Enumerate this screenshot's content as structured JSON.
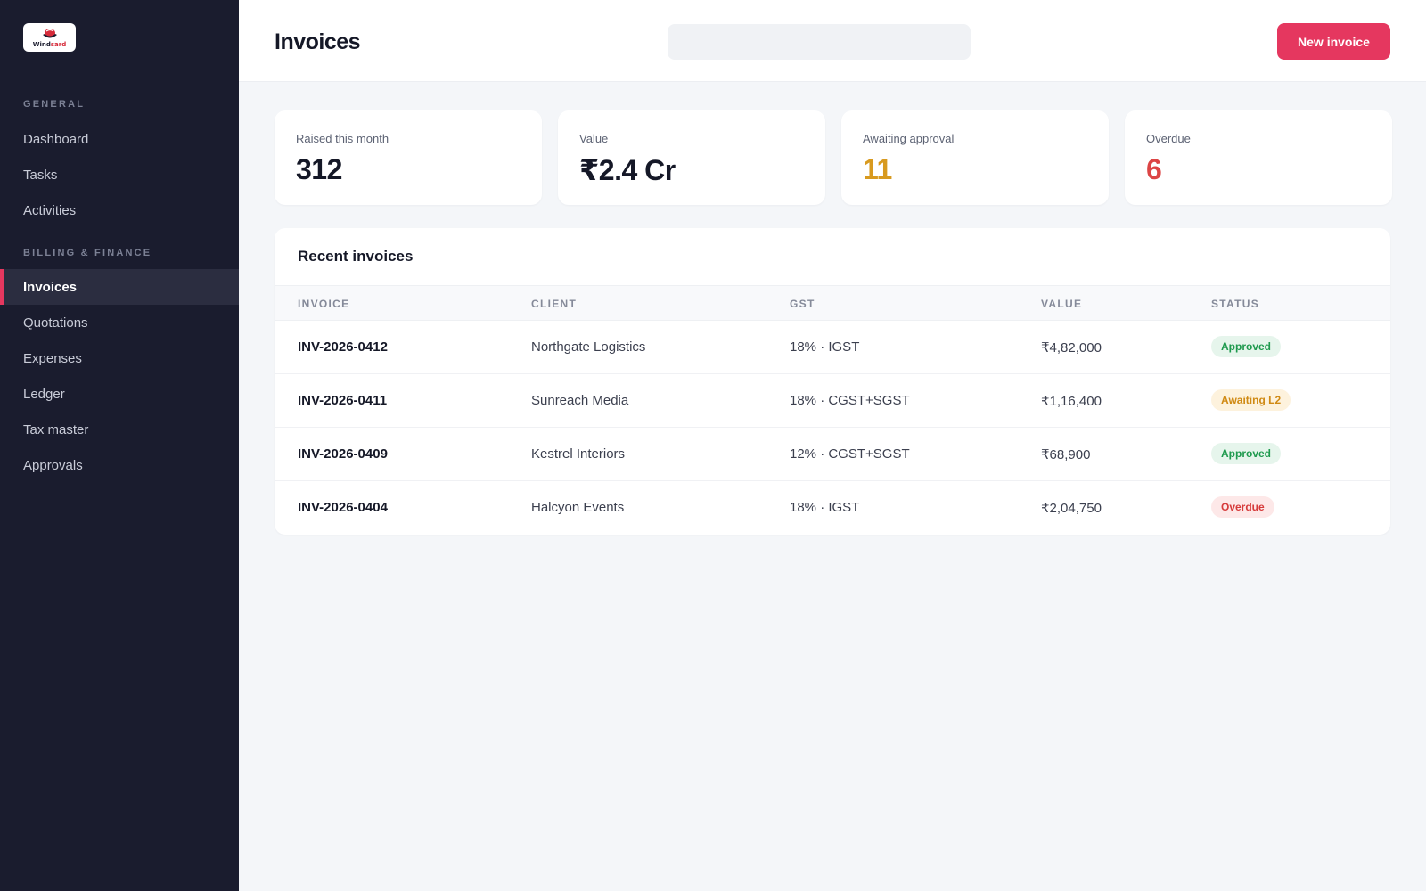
{
  "brand": {
    "logo_text_a": "Wind",
    "logo_text_b": "sard"
  },
  "sidebar": {
    "sections": [
      {
        "label": "GENERAL",
        "items": [
          "Dashboard",
          "Tasks",
          "Activities"
        ]
      },
      {
        "label": "BILLING & FINANCE",
        "items": [
          "Invoices",
          "Quotations",
          "Expenses",
          "Ledger",
          "Tax master",
          "Approvals"
        ]
      }
    ],
    "active_item": "Invoices"
  },
  "header": {
    "title": "Invoices",
    "search_placeholder": "",
    "new_button_label": "New invoice"
  },
  "stats": [
    {
      "label": "Raised this month",
      "value": "312",
      "color": "#151827"
    },
    {
      "label": "Value",
      "value": "₹2.4 Cr",
      "color": "#151827"
    },
    {
      "label": "Awaiting approval",
      "value": "11",
      "color": "#d89a1f"
    },
    {
      "label": "Overdue",
      "value": "6",
      "color": "#dc4545"
    }
  ],
  "table": {
    "title": "Recent invoices",
    "columns": [
      "INVOICE",
      "CLIENT",
      "GST",
      "VALUE",
      "STATUS"
    ],
    "rows": [
      {
        "invoice": "INV-2026-0412",
        "client": "Northgate Logistics",
        "gst": "18% · IGST",
        "value": "₹4,82,000",
        "status": "Approved",
        "status_kind": "approved"
      },
      {
        "invoice": "INV-2026-0411",
        "client": "Sunreach Media",
        "gst": "18% · CGST+SGST",
        "value": "₹1,16,400",
        "status": "Awaiting L2",
        "status_kind": "awaiting"
      },
      {
        "invoice": "INV-2026-0409",
        "client": "Kestrel Interiors",
        "gst": "12% · CGST+SGST",
        "value": "₹68,900",
        "status": "Approved",
        "status_kind": "approved"
      },
      {
        "invoice": "INV-2026-0404",
        "client": "Halcyon Events",
        "gst": "18% · IGST",
        "value": "₹2,04,750",
        "status": "Overdue",
        "status_kind": "overdue"
      }
    ]
  },
  "colors": {
    "accent": "#e5375f",
    "sidebar_bg": "#1a1c2e",
    "approved_bg": "#e6f5ec",
    "approved_fg": "#1f9a4e",
    "awaiting_bg": "#fdf2dd",
    "awaiting_fg": "#d08a14",
    "overdue_bg": "#fde8e8",
    "overdue_fg": "#d63b3b"
  }
}
